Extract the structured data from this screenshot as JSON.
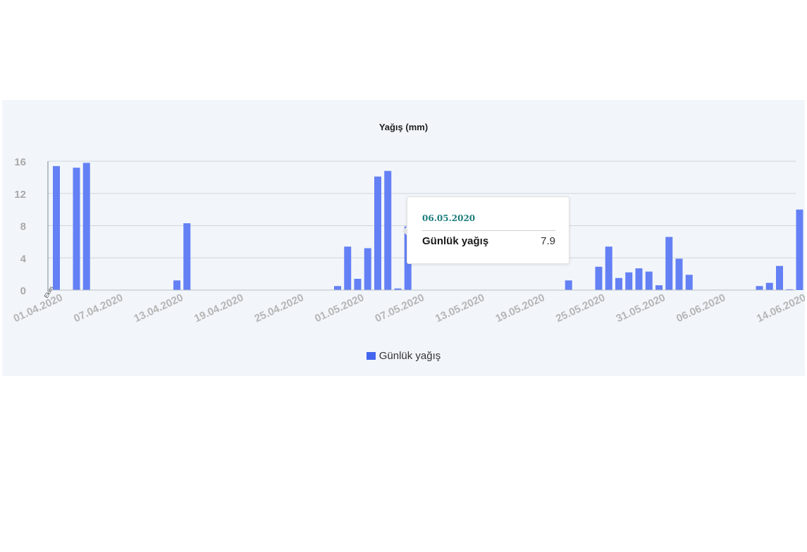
{
  "chart_data": {
    "type": "bar",
    "title": "Yağış (mm)",
    "xlabel": "",
    "ylabel": "",
    "x_corner_label": "Ekim",
    "ylim": [
      0,
      16
    ],
    "yticks": [
      0,
      4,
      8,
      12,
      16
    ],
    "grid": true,
    "legend_position": "bottom",
    "bar_color": "#6480f5",
    "legend_color": "#4466ee",
    "tick_labels": [
      "01.04.2020",
      "07.04.2020",
      "13.04.2020",
      "19.04.2020",
      "25.04.2020",
      "01.05.2020",
      "07.05.2020",
      "13.05.2020",
      "19.05.2020",
      "25.05.2020",
      "31.05.2020",
      "06.06.2020",
      "14.06.2020"
    ],
    "tick_label_index": [
      0,
      6,
      12,
      18,
      24,
      30,
      36,
      42,
      48,
      54,
      60,
      66,
      74
    ],
    "categories": [
      "01.04.2020",
      "02.04.2020",
      "03.04.2020",
      "04.04.2020",
      "05.04.2020",
      "06.04.2020",
      "07.04.2020",
      "08.04.2020",
      "09.04.2020",
      "10.04.2020",
      "11.04.2020",
      "12.04.2020",
      "13.04.2020",
      "14.04.2020",
      "15.04.2020",
      "16.04.2020",
      "17.04.2020",
      "18.04.2020",
      "19.04.2020",
      "20.04.2020",
      "21.04.2020",
      "22.04.2020",
      "23.04.2020",
      "24.04.2020",
      "25.04.2020",
      "26.04.2020",
      "27.04.2020",
      "28.04.2020",
      "29.04.2020",
      "30.04.2020",
      "01.05.2020",
      "02.05.2020",
      "03.05.2020",
      "04.05.2020",
      "05.05.2020",
      "06.05.2020",
      "07.05.2020",
      "08.05.2020",
      "09.05.2020",
      "10.05.2020",
      "11.05.2020",
      "12.05.2020",
      "13.05.2020",
      "14.05.2020",
      "15.05.2020",
      "16.05.2020",
      "17.05.2020",
      "18.05.2020",
      "19.05.2020",
      "20.05.2020",
      "21.05.2020",
      "22.05.2020",
      "23.05.2020",
      "24.05.2020",
      "25.05.2020",
      "26.05.2020",
      "27.05.2020",
      "28.05.2020",
      "29.05.2020",
      "30.05.2020",
      "31.05.2020",
      "01.06.2020",
      "02.06.2020",
      "03.06.2020",
      "04.06.2020",
      "05.06.2020",
      "06.06.2020",
      "07.06.2020",
      "08.06.2020",
      "09.06.2020",
      "10.06.2020",
      "11.06.2020",
      "12.06.2020",
      "13.06.2020",
      "14.06.2020"
    ],
    "series": [
      {
        "name": "Günlük yağış",
        "values": [
          15.4,
          0,
          15.2,
          15.8,
          0,
          0,
          0,
          0,
          0,
          0,
          0,
          0,
          1.2,
          8.3,
          0,
          0,
          0,
          0,
          0,
          0,
          0,
          0,
          0,
          0,
          0,
          0,
          0,
          0,
          0.5,
          5.4,
          1.4,
          5.2,
          14.1,
          14.8,
          0.2,
          7.9,
          0,
          0,
          0,
          0,
          0,
          0,
          0,
          0,
          0,
          0,
          0,
          0,
          0,
          0,
          0,
          1.2,
          0,
          0,
          2.9,
          5.4,
          1.5,
          2.2,
          2.7,
          2.3,
          0.6,
          6.6,
          3.9,
          1.9,
          0,
          0,
          0,
          0,
          0,
          0,
          0.5,
          0.9,
          3.0,
          0.1,
          10.0
        ]
      }
    ],
    "tooltip": {
      "date": "06.05.2020",
      "series_name": "Günlük yağış",
      "value": "7.9",
      "date_color": "#1d7d7d"
    }
  }
}
